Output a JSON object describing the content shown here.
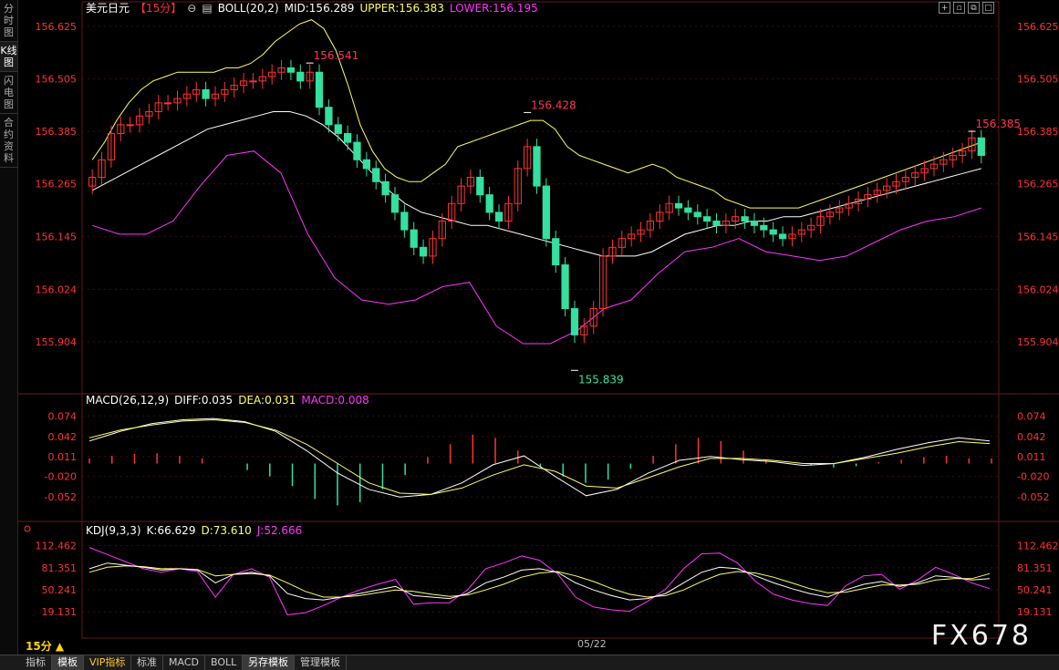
{
  "sidebar": {
    "tabs": [
      {
        "label": "分时图",
        "active": false
      },
      {
        "label": "K线图",
        "active": true
      },
      {
        "label": "闪电图",
        "active": false
      },
      {
        "label": "合约资料",
        "active": false
      }
    ]
  },
  "header": {
    "symbol": "美元日元",
    "period_tag": "【15分】",
    "boll_label": "BOLL(20,2)",
    "boll_mid": "MID:156.289",
    "boll_upper": "UPPER:156.383",
    "boll_lower": "LOWER:156.195"
  },
  "macd_header": {
    "name": "MACD(26,12,9)",
    "diff": "DIFF:0.035",
    "dea": "DEA:0.031",
    "macd": "MACD:0.008"
  },
  "kdj_header": {
    "name": "KDJ(9,3,3)",
    "k": "K:66.629",
    "d": "D:73.610",
    "j": "J:52.666"
  },
  "colors": {
    "up": "#ff3333",
    "down": "#33e0a0",
    "upper": "#ffff66",
    "lower": "#ff33ff",
    "mid": "#ffffff",
    "axis": "#ff3333",
    "grid": "#3a1010"
  },
  "chart_data": [
    {
      "type": "candlestick",
      "title": "美元日元【15分】",
      "y_ticks": [
        "156.625",
        "156.505",
        "156.385",
        "156.265",
        "156.145",
        "156.024",
        "155.904"
      ],
      "ylim": [
        155.8,
        156.66
      ],
      "annotations": [
        {
          "label": "156.541",
          "index": 23
        },
        {
          "label": "156.428",
          "index": 46
        },
        {
          "label": "155.839",
          "index": 51
        },
        {
          "label": "156.385",
          "index": 93
        }
      ],
      "close": [
        156.28,
        156.32,
        156.38,
        156.4,
        156.4,
        156.42,
        156.43,
        156.45,
        156.45,
        156.46,
        156.47,
        156.48,
        156.46,
        156.47,
        156.48,
        156.49,
        156.5,
        156.5,
        156.51,
        156.52,
        156.53,
        156.52,
        156.5,
        156.52,
        156.44,
        156.4,
        156.38,
        156.36,
        156.32,
        156.3,
        156.27,
        156.24,
        156.2,
        156.16,
        156.12,
        156.1,
        156.14,
        156.18,
        156.22,
        156.26,
        156.28,
        156.24,
        156.2,
        156.18,
        156.22,
        156.3,
        156.35,
        156.26,
        156.14,
        156.08,
        155.98,
        155.92,
        155.94,
        155.98,
        156.1,
        156.12,
        156.14,
        156.15,
        156.16,
        156.18,
        156.2,
        156.22,
        156.21,
        156.2,
        156.19,
        156.18,
        156.17,
        156.18,
        156.19,
        156.18,
        156.17,
        156.16,
        156.15,
        156.14,
        156.15,
        156.16,
        156.17,
        156.19,
        156.2,
        156.21,
        156.22,
        156.23,
        156.24,
        156.25,
        156.26,
        156.27,
        156.28,
        156.29,
        156.3,
        156.31,
        156.32,
        156.33,
        156.34,
        156.37,
        156.33
      ],
      "boll": {
        "upper": [
          156.32,
          156.36,
          156.41,
          156.45,
          156.48,
          156.5,
          156.51,
          156.52,
          156.52,
          156.52,
          156.52,
          156.53,
          156.53,
          156.54,
          156.56,
          156.59,
          156.61,
          156.63,
          156.64,
          156.62,
          156.57,
          156.49,
          156.4,
          156.34,
          156.3,
          156.28,
          156.27,
          156.27,
          156.29,
          156.31,
          156.35,
          156.36,
          156.37,
          156.38,
          156.39,
          156.4,
          156.41,
          156.41,
          156.39,
          156.35,
          156.33,
          156.32,
          156.31,
          156.3,
          156.29,
          156.3,
          156.31,
          156.3,
          156.28,
          156.27,
          156.26,
          156.25,
          156.23,
          156.22,
          156.21,
          156.21,
          156.21,
          156.21,
          156.21,
          156.22,
          156.23,
          156.24,
          156.25,
          156.26,
          156.27,
          156.28,
          156.29,
          156.3,
          156.31,
          156.32,
          156.33,
          156.34,
          156.35,
          156.36
        ],
        "mid": [
          156.25,
          156.27,
          156.29,
          156.31,
          156.33,
          156.35,
          156.37,
          156.39,
          156.4,
          156.41,
          156.42,
          156.43,
          156.43,
          156.42,
          156.4,
          156.37,
          156.33,
          156.29,
          156.25,
          156.22,
          156.2,
          156.19,
          156.18,
          156.17,
          156.17,
          156.16,
          156.15,
          156.14,
          156.13,
          156.12,
          156.11,
          156.1,
          156.1,
          156.1,
          156.11,
          156.13,
          156.15,
          156.16,
          156.17,
          156.17,
          156.18,
          156.18,
          156.19,
          156.19,
          156.2,
          156.21,
          156.22,
          156.23,
          156.24,
          156.25,
          156.26,
          156.27,
          156.28,
          156.29,
          156.3
        ],
        "lower": [
          156.17,
          156.15,
          156.15,
          156.18,
          156.26,
          156.33,
          156.34,
          156.29,
          156.15,
          156.05,
          156.0,
          155.99,
          156.0,
          156.03,
          156.04,
          155.94,
          155.9,
          155.9,
          155.93,
          155.98,
          156.0,
          156.06,
          156.11,
          156.12,
          156.14,
          156.11,
          156.1,
          156.09,
          156.1,
          156.13,
          156.16,
          156.18,
          156.19,
          156.21
        ]
      }
    },
    {
      "type": "bar",
      "title": "MACD(26,12,9)",
      "y_ticks": [
        "0.074",
        "0.042",
        "0.011",
        "-0.020",
        "-0.052"
      ],
      "ylim": [
        -0.08,
        0.09
      ],
      "diff": [
        0.035,
        0.05,
        0.062,
        0.068,
        0.07,
        0.065,
        0.05,
        0.02,
        -0.015,
        -0.04,
        -0.052,
        -0.048,
        -0.03,
        -0.002,
        0.012,
        -0.02,
        -0.05,
        -0.04,
        -0.015,
        0.005,
        0.011,
        0.006,
        0.003,
        -0.003,
        0.0,
        0.01,
        0.022,
        0.032,
        0.04,
        0.035
      ],
      "dea": [
        0.04,
        0.052,
        0.06,
        0.066,
        0.068,
        0.064,
        0.052,
        0.03,
        0.0,
        -0.03,
        -0.046,
        -0.048,
        -0.038,
        -0.018,
        -0.002,
        -0.012,
        -0.035,
        -0.038,
        -0.022,
        -0.005,
        0.008,
        0.008,
        0.005,
        0.0,
        0.0,
        0.008,
        0.016,
        0.026,
        0.034,
        0.031
      ],
      "macd": [
        0.008,
        0.012,
        0.015,
        0.016,
        0.012,
        0.008,
        0.0,
        -0.01,
        -0.02,
        -0.035,
        -0.055,
        -0.065,
        -0.06,
        -0.04,
        -0.018,
        0.01,
        0.03,
        0.045,
        0.04,
        0.02,
        -0.005,
        -0.02,
        -0.03,
        -0.025,
        -0.008,
        0.012,
        0.03,
        0.04,
        0.035,
        0.02,
        0.005,
        0.0,
        -0.003,
        -0.006,
        -0.004,
        0.002,
        0.006,
        0.01,
        0.012,
        0.008,
        0.008
      ]
    },
    {
      "type": "line",
      "title": "KDJ(9,3,3)",
      "y_ticks": [
        "112.462",
        "81.351",
        "50.241",
        "19.131"
      ],
      "ylim": [
        -5,
        130
      ],
      "k": [
        80,
        88,
        85,
        82,
        78,
        80,
        78,
        60,
        72,
        75,
        70,
        45,
        38,
        36,
        40,
        45,
        50,
        55,
        42,
        40,
        38,
        45,
        60,
        68,
        78,
        80,
        75,
        60,
        50,
        42,
        36,
        38,
        45,
        60,
        75,
        82,
        80,
        70,
        60,
        52,
        45,
        40,
        50,
        58,
        62,
        55,
        60,
        70,
        68,
        64,
        66
      ],
      "d": [
        75,
        82,
        84,
        83,
        80,
        80,
        79,
        70,
        72,
        73,
        71,
        60,
        48,
        40,
        40,
        42,
        46,
        50,
        48,
        44,
        41,
        43,
        50,
        58,
        68,
        74,
        76,
        70,
        62,
        52,
        44,
        40,
        42,
        50,
        62,
        72,
        76,
        74,
        68,
        60,
        52,
        46,
        47,
        52,
        57,
        57,
        58,
        64,
        66,
        66,
        73
      ],
      "j": [
        110,
        100,
        90,
        80,
        75,
        80,
        76,
        40,
        72,
        80,
        68,
        15,
        18,
        28,
        40,
        50,
        58,
        65,
        30,
        32,
        32,
        50,
        80,
        88,
        98,
        92,
        73,
        40,
        26,
        22,
        20,
        34,
        51,
        80,
        101,
        102,
        88,
        62,
        44,
        36,
        31,
        28,
        56,
        70,
        72,
        51,
        64,
        82,
        72,
        60,
        52
      ]
    }
  ],
  "axis_x": {
    "date_label": "05/22"
  },
  "period_selector": {
    "label": "15分 ▲"
  },
  "statusbar": {
    "buttons": [
      {
        "label": "指标",
        "active": false,
        "vip": false
      },
      {
        "label": "模板",
        "active": true,
        "vip": false
      },
      {
        "label": "VIP指标",
        "active": false,
        "vip": true
      },
      {
        "label": "标准",
        "active": false,
        "vip": false
      },
      {
        "label": "MACD",
        "active": false,
        "vip": false
      },
      {
        "label": "BOLL",
        "active": false,
        "vip": false
      },
      {
        "label": "另存模板",
        "active": true,
        "vip": false
      },
      {
        "label": "管理模板",
        "active": false,
        "vip": false
      }
    ]
  },
  "watermark": "FX678"
}
